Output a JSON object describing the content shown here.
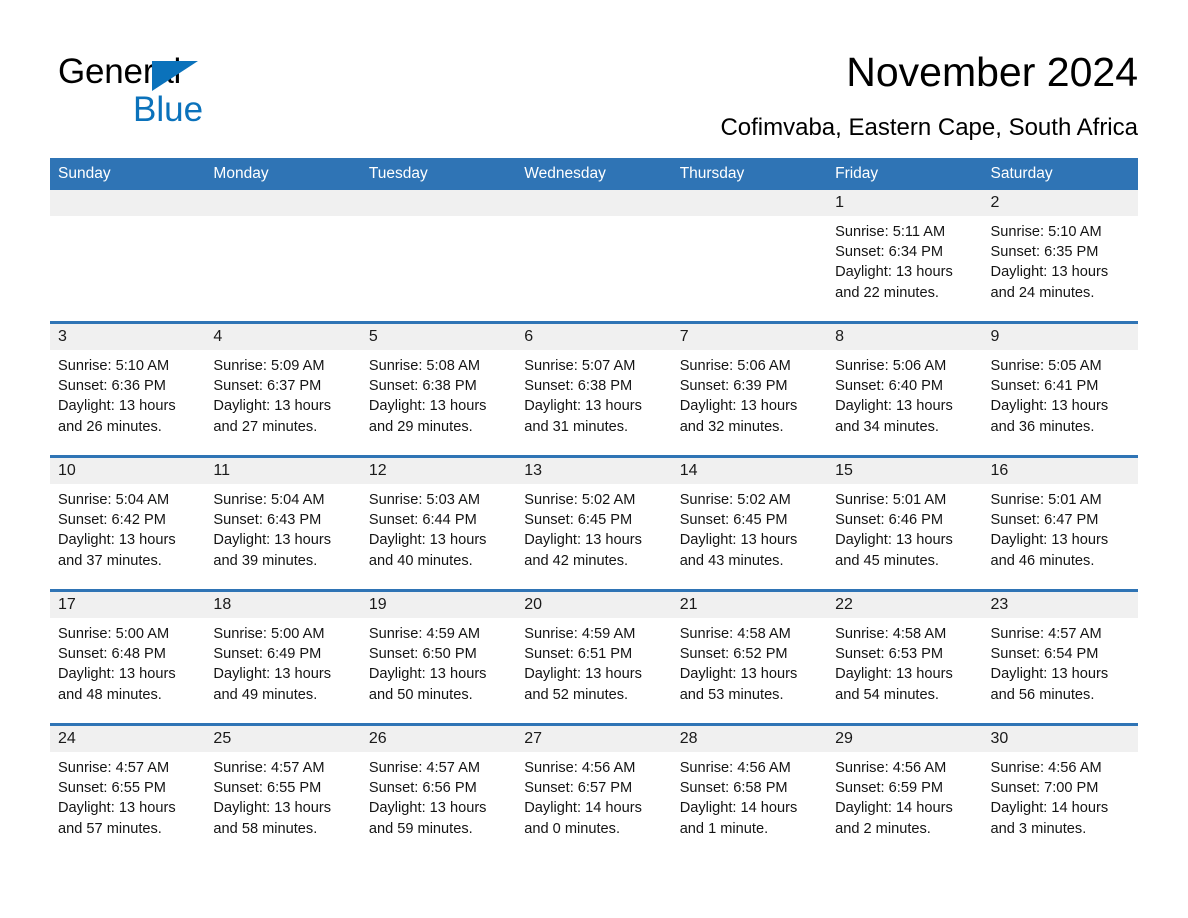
{
  "brand": {
    "name_part1": "General",
    "name_part2": "Blue",
    "triangle_color": "#0b72bb"
  },
  "header": {
    "title": "November 2024",
    "subtitle": "Cofimvaba, Eastern Cape, South Africa"
  },
  "theme": {
    "header_blue": "#2f74b5",
    "daynum_gray": "#f0f0f0",
    "text_black": "#000000"
  },
  "weekday_headers": [
    "Sunday",
    "Monday",
    "Tuesday",
    "Wednesday",
    "Thursday",
    "Friday",
    "Saturday"
  ],
  "weeks": [
    [
      {
        "day": "",
        "sunrise": "",
        "sunset": "",
        "daylight_line1": "",
        "daylight_line2": ""
      },
      {
        "day": "",
        "sunrise": "",
        "sunset": "",
        "daylight_line1": "",
        "daylight_line2": ""
      },
      {
        "day": "",
        "sunrise": "",
        "sunset": "",
        "daylight_line1": "",
        "daylight_line2": ""
      },
      {
        "day": "",
        "sunrise": "",
        "sunset": "",
        "daylight_line1": "",
        "daylight_line2": ""
      },
      {
        "day": "",
        "sunrise": "",
        "sunset": "",
        "daylight_line1": "",
        "daylight_line2": ""
      },
      {
        "day": "1",
        "sunrise": "Sunrise: 5:11 AM",
        "sunset": "Sunset: 6:34 PM",
        "daylight_line1": "Daylight: 13 hours",
        "daylight_line2": "and 22 minutes."
      },
      {
        "day": "2",
        "sunrise": "Sunrise: 5:10 AM",
        "sunset": "Sunset: 6:35 PM",
        "daylight_line1": "Daylight: 13 hours",
        "daylight_line2": "and 24 minutes."
      }
    ],
    [
      {
        "day": "3",
        "sunrise": "Sunrise: 5:10 AM",
        "sunset": "Sunset: 6:36 PM",
        "daylight_line1": "Daylight: 13 hours",
        "daylight_line2": "and 26 minutes."
      },
      {
        "day": "4",
        "sunrise": "Sunrise: 5:09 AM",
        "sunset": "Sunset: 6:37 PM",
        "daylight_line1": "Daylight: 13 hours",
        "daylight_line2": "and 27 minutes."
      },
      {
        "day": "5",
        "sunrise": "Sunrise: 5:08 AM",
        "sunset": "Sunset: 6:38 PM",
        "daylight_line1": "Daylight: 13 hours",
        "daylight_line2": "and 29 minutes."
      },
      {
        "day": "6",
        "sunrise": "Sunrise: 5:07 AM",
        "sunset": "Sunset: 6:38 PM",
        "daylight_line1": "Daylight: 13 hours",
        "daylight_line2": "and 31 minutes."
      },
      {
        "day": "7",
        "sunrise": "Sunrise: 5:06 AM",
        "sunset": "Sunset: 6:39 PM",
        "daylight_line1": "Daylight: 13 hours",
        "daylight_line2": "and 32 minutes."
      },
      {
        "day": "8",
        "sunrise": "Sunrise: 5:06 AM",
        "sunset": "Sunset: 6:40 PM",
        "daylight_line1": "Daylight: 13 hours",
        "daylight_line2": "and 34 minutes."
      },
      {
        "day": "9",
        "sunrise": "Sunrise: 5:05 AM",
        "sunset": "Sunset: 6:41 PM",
        "daylight_line1": "Daylight: 13 hours",
        "daylight_line2": "and 36 minutes."
      }
    ],
    [
      {
        "day": "10",
        "sunrise": "Sunrise: 5:04 AM",
        "sunset": "Sunset: 6:42 PM",
        "daylight_line1": "Daylight: 13 hours",
        "daylight_line2": "and 37 minutes."
      },
      {
        "day": "11",
        "sunrise": "Sunrise: 5:04 AM",
        "sunset": "Sunset: 6:43 PM",
        "daylight_line1": "Daylight: 13 hours",
        "daylight_line2": "and 39 minutes."
      },
      {
        "day": "12",
        "sunrise": "Sunrise: 5:03 AM",
        "sunset": "Sunset: 6:44 PM",
        "daylight_line1": "Daylight: 13 hours",
        "daylight_line2": "and 40 minutes."
      },
      {
        "day": "13",
        "sunrise": "Sunrise: 5:02 AM",
        "sunset": "Sunset: 6:45 PM",
        "daylight_line1": "Daylight: 13 hours",
        "daylight_line2": "and 42 minutes."
      },
      {
        "day": "14",
        "sunrise": "Sunrise: 5:02 AM",
        "sunset": "Sunset: 6:45 PM",
        "daylight_line1": "Daylight: 13 hours",
        "daylight_line2": "and 43 minutes."
      },
      {
        "day": "15",
        "sunrise": "Sunrise: 5:01 AM",
        "sunset": "Sunset: 6:46 PM",
        "daylight_line1": "Daylight: 13 hours",
        "daylight_line2": "and 45 minutes."
      },
      {
        "day": "16",
        "sunrise": "Sunrise: 5:01 AM",
        "sunset": "Sunset: 6:47 PM",
        "daylight_line1": "Daylight: 13 hours",
        "daylight_line2": "and 46 minutes."
      }
    ],
    [
      {
        "day": "17",
        "sunrise": "Sunrise: 5:00 AM",
        "sunset": "Sunset: 6:48 PM",
        "daylight_line1": "Daylight: 13 hours",
        "daylight_line2": "and 48 minutes."
      },
      {
        "day": "18",
        "sunrise": "Sunrise: 5:00 AM",
        "sunset": "Sunset: 6:49 PM",
        "daylight_line1": "Daylight: 13 hours",
        "daylight_line2": "and 49 minutes."
      },
      {
        "day": "19",
        "sunrise": "Sunrise: 4:59 AM",
        "sunset": "Sunset: 6:50 PM",
        "daylight_line1": "Daylight: 13 hours",
        "daylight_line2": "and 50 minutes."
      },
      {
        "day": "20",
        "sunrise": "Sunrise: 4:59 AM",
        "sunset": "Sunset: 6:51 PM",
        "daylight_line1": "Daylight: 13 hours",
        "daylight_line2": "and 52 minutes."
      },
      {
        "day": "21",
        "sunrise": "Sunrise: 4:58 AM",
        "sunset": "Sunset: 6:52 PM",
        "daylight_line1": "Daylight: 13 hours",
        "daylight_line2": "and 53 minutes."
      },
      {
        "day": "22",
        "sunrise": "Sunrise: 4:58 AM",
        "sunset": "Sunset: 6:53 PM",
        "daylight_line1": "Daylight: 13 hours",
        "daylight_line2": "and 54 minutes."
      },
      {
        "day": "23",
        "sunrise": "Sunrise: 4:57 AM",
        "sunset": "Sunset: 6:54 PM",
        "daylight_line1": "Daylight: 13 hours",
        "daylight_line2": "and 56 minutes."
      }
    ],
    [
      {
        "day": "24",
        "sunrise": "Sunrise: 4:57 AM",
        "sunset": "Sunset: 6:55 PM",
        "daylight_line1": "Daylight: 13 hours",
        "daylight_line2": "and 57 minutes."
      },
      {
        "day": "25",
        "sunrise": "Sunrise: 4:57 AM",
        "sunset": "Sunset: 6:55 PM",
        "daylight_line1": "Daylight: 13 hours",
        "daylight_line2": "and 58 minutes."
      },
      {
        "day": "26",
        "sunrise": "Sunrise: 4:57 AM",
        "sunset": "Sunset: 6:56 PM",
        "daylight_line1": "Daylight: 13 hours",
        "daylight_line2": "and 59 minutes."
      },
      {
        "day": "27",
        "sunrise": "Sunrise: 4:56 AM",
        "sunset": "Sunset: 6:57 PM",
        "daylight_line1": "Daylight: 14 hours",
        "daylight_line2": "and 0 minutes."
      },
      {
        "day": "28",
        "sunrise": "Sunrise: 4:56 AM",
        "sunset": "Sunset: 6:58 PM",
        "daylight_line1": "Daylight: 14 hours",
        "daylight_line2": "and 1 minute."
      },
      {
        "day": "29",
        "sunrise": "Sunrise: 4:56 AM",
        "sunset": "Sunset: 6:59 PM",
        "daylight_line1": "Daylight: 14 hours",
        "daylight_line2": "and 2 minutes."
      },
      {
        "day": "30",
        "sunrise": "Sunrise: 4:56 AM",
        "sunset": "Sunset: 7:00 PM",
        "daylight_line1": "Daylight: 14 hours",
        "daylight_line2": "and 3 minutes."
      }
    ]
  ]
}
